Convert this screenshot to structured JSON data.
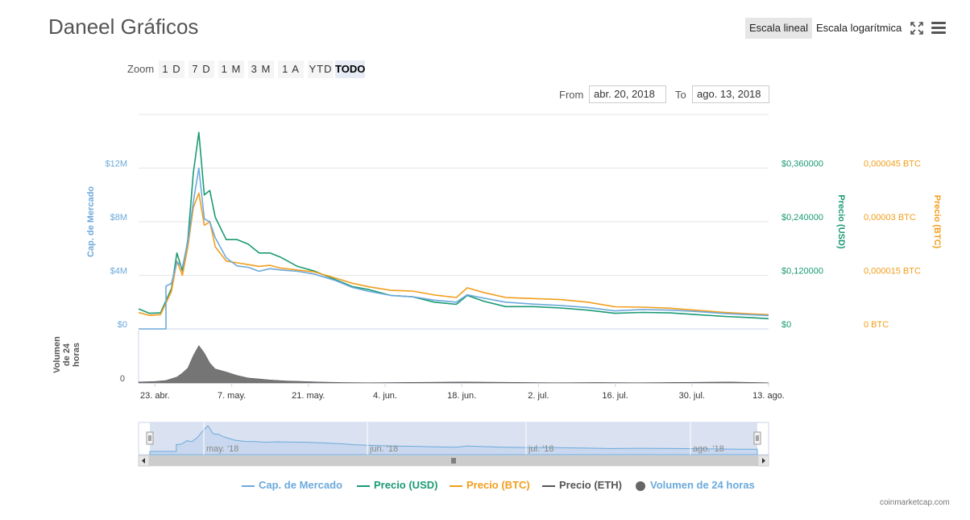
{
  "header": {
    "title": "Daneel Gráficos",
    "linear_scale": "Escala lineal",
    "log_scale": "Escala logarítmica"
  },
  "zoom": {
    "label": "Zoom",
    "buttons": [
      "1 D",
      "7 D",
      "1 M",
      "3 M",
      "1 A",
      "YTD",
      "TODO"
    ],
    "active": "TODO"
  },
  "range": {
    "from_label": "From",
    "from_value": "abr. 20, 2018",
    "to_label": "To",
    "to_value": "ago. 13, 2018"
  },
  "legend": {
    "market_cap": "Cap. de Mercado",
    "price_usd": "Precio (USD)",
    "price_btc": "Precio (BTC)",
    "price_eth": "Precio (ETH)",
    "volume": "Volumen de 24 horas"
  },
  "credits": "coinmarketcap.com",
  "colors": {
    "market_cap": "#6ca9dc",
    "price_usd": "#1a9a74",
    "price_btc": "#f29e1c",
    "price_eth": "#555555",
    "volume": "#555555",
    "navigator_fill": "#d4dcef"
  },
  "chart_data": {
    "type": "line",
    "x_range": [
      "2018-04-20",
      "2018-08-13"
    ],
    "x_ticks": [
      "23. abr.",
      "7. may.",
      "21. may.",
      "4. jun.",
      "18. jun.",
      "2. jul.",
      "16. jul.",
      "30. jul.",
      "13. ago."
    ],
    "axes": {
      "market_cap": {
        "title": "Cap. de Mercado",
        "ticks": [
          "$0",
          "$4M",
          "$8M",
          "$12M"
        ],
        "ylim": [
          0,
          16000000
        ]
      },
      "price_usd": {
        "title": "Precio (USD)",
        "ticks": [
          "$0",
          "$0,120000",
          "$0,240000",
          "$0,360000"
        ],
        "ylim": [
          0,
          0.48
        ]
      },
      "price_btc": {
        "title": "Precio (BTC)",
        "ticks": [
          "0 BTC",
          "0,000015 BTC",
          "0,00003 BTC",
          "0,000045 BTC"
        ],
        "ylim": [
          0,
          6e-05
        ]
      },
      "volume": {
        "title": "Volumen de 24 horas",
        "ticks": [
          "0"
        ]
      }
    },
    "navigator_ticks": [
      "may. '18",
      "jun. '18",
      "jul. '18",
      "ago. '18"
    ],
    "series": [
      {
        "name": "Precio (USD)",
        "axis": "price_usd",
        "color": "#1a9a74",
        "points": [
          [
            "2018-04-20",
            0.045
          ],
          [
            "2018-04-22",
            0.035
          ],
          [
            "2018-04-24",
            0.036
          ],
          [
            "2018-04-26",
            0.09
          ],
          [
            "2018-04-27",
            0.17
          ],
          [
            "2018-04-28",
            0.13
          ],
          [
            "2018-04-29",
            0.2
          ],
          [
            "2018-04-30",
            0.35
          ],
          [
            "2018-05-01",
            0.44
          ],
          [
            "2018-05-02",
            0.3
          ],
          [
            "2018-05-03",
            0.31
          ],
          [
            "2018-05-04",
            0.25
          ],
          [
            "2018-05-06",
            0.2
          ],
          [
            "2018-05-08",
            0.2
          ],
          [
            "2018-05-10",
            0.19
          ],
          [
            "2018-05-12",
            0.17
          ],
          [
            "2018-05-14",
            0.17
          ],
          [
            "2018-05-16",
            0.16
          ],
          [
            "2018-05-19",
            0.14
          ],
          [
            "2018-05-22",
            0.13
          ],
          [
            "2018-05-26",
            0.11
          ],
          [
            "2018-05-29",
            0.095
          ],
          [
            "2018-06-01",
            0.088
          ],
          [
            "2018-06-05",
            0.075
          ],
          [
            "2018-06-09",
            0.072
          ],
          [
            "2018-06-13",
            0.06
          ],
          [
            "2018-06-17",
            0.055
          ],
          [
            "2018-06-19",
            0.075
          ],
          [
            "2018-06-22",
            0.062
          ],
          [
            "2018-06-26",
            0.05
          ],
          [
            "2018-07-01",
            0.05
          ],
          [
            "2018-07-06",
            0.047
          ],
          [
            "2018-07-11",
            0.042
          ],
          [
            "2018-07-16",
            0.035
          ],
          [
            "2018-07-21",
            0.037
          ],
          [
            "2018-07-26",
            0.036
          ],
          [
            "2018-07-31",
            0.032
          ],
          [
            "2018-08-05",
            0.028
          ],
          [
            "2018-08-10",
            0.025
          ],
          [
            "2018-08-13",
            0.023
          ]
        ]
      },
      {
        "name": "Precio (BTC)",
        "axis": "price_btc",
        "color": "#f29e1c",
        "points": [
          [
            "2018-04-20",
            4.6e-06
          ],
          [
            "2018-04-22",
            3.8e-06
          ],
          [
            "2018-04-24",
            4e-06
          ],
          [
            "2018-04-26",
            1.05e-05
          ],
          [
            "2018-04-27",
            1.9e-05
          ],
          [
            "2018-04-28",
            1.5e-05
          ],
          [
            "2018-04-29",
            2.3e-05
          ],
          [
            "2018-04-30",
            3.4e-05
          ],
          [
            "2018-05-01",
            3.8e-05
          ],
          [
            "2018-05-02",
            2.9e-05
          ],
          [
            "2018-05-03",
            3e-05
          ],
          [
            "2018-05-04",
            2.3e-05
          ],
          [
            "2018-05-06",
            1.9e-05
          ],
          [
            "2018-05-08",
            1.85e-05
          ],
          [
            "2018-05-10",
            1.8e-05
          ],
          [
            "2018-05-12",
            1.75e-05
          ],
          [
            "2018-05-14",
            1.78e-05
          ],
          [
            "2018-05-16",
            1.7e-05
          ],
          [
            "2018-05-19",
            1.65e-05
          ],
          [
            "2018-05-22",
            1.6e-05
          ],
          [
            "2018-05-26",
            1.42e-05
          ],
          [
            "2018-05-29",
            1.28e-05
          ],
          [
            "2018-06-01",
            1.18e-05
          ],
          [
            "2018-06-05",
            1.08e-05
          ],
          [
            "2018-06-09",
            1.06e-05
          ],
          [
            "2018-06-13",
            9.5e-06
          ],
          [
            "2018-06-17",
            8.8e-06
          ],
          [
            "2018-06-19",
            1.15e-05
          ],
          [
            "2018-06-22",
            1.02e-05
          ],
          [
            "2018-06-26",
            8.8e-06
          ],
          [
            "2018-07-01",
            8.5e-06
          ],
          [
            "2018-07-06",
            8.2e-06
          ],
          [
            "2018-07-11",
            7.5e-06
          ],
          [
            "2018-07-16",
            6.2e-06
          ],
          [
            "2018-07-21",
            6.1e-06
          ],
          [
            "2018-07-26",
            5.8e-06
          ],
          [
            "2018-07-31",
            5.2e-06
          ],
          [
            "2018-08-05",
            4.6e-06
          ],
          [
            "2018-08-10",
            4.2e-06
          ],
          [
            "2018-08-13",
            4e-06
          ]
        ]
      },
      {
        "name": "Cap. de Mercado",
        "axis": "market_cap",
        "color": "#6ca9dc",
        "points": [
          [
            "2018-04-20",
            0
          ],
          [
            "2018-04-22",
            0
          ],
          [
            "2018-04-24",
            0
          ],
          [
            "2018-04-25",
            0
          ],
          [
            "2018-04-25",
            3200000
          ],
          [
            "2018-04-26",
            3400000
          ],
          [
            "2018-04-27",
            5000000
          ],
          [
            "2018-04-28",
            4600000
          ],
          [
            "2018-04-29",
            6500000
          ],
          [
            "2018-04-30",
            9500000
          ],
          [
            "2018-05-01",
            12000000
          ],
          [
            "2018-05-02",
            8200000
          ],
          [
            "2018-05-03",
            8000000
          ],
          [
            "2018-05-04",
            6800000
          ],
          [
            "2018-05-06",
            5300000
          ],
          [
            "2018-05-08",
            4700000
          ],
          [
            "2018-05-10",
            4600000
          ],
          [
            "2018-05-12",
            4300000
          ],
          [
            "2018-05-14",
            4500000
          ],
          [
            "2018-05-16",
            4400000
          ],
          [
            "2018-05-19",
            4300000
          ],
          [
            "2018-05-22",
            4100000
          ],
          [
            "2018-05-26",
            3600000
          ],
          [
            "2018-05-29",
            3100000
          ],
          [
            "2018-06-01",
            2800000
          ],
          [
            "2018-06-05",
            2500000
          ],
          [
            "2018-06-09",
            2400000
          ],
          [
            "2018-06-13",
            2150000
          ],
          [
            "2018-06-17",
            2000000
          ],
          [
            "2018-06-19",
            2550000
          ],
          [
            "2018-06-22",
            2300000
          ],
          [
            "2018-06-26",
            2000000
          ],
          [
            "2018-07-01",
            1850000
          ],
          [
            "2018-07-06",
            1750000
          ],
          [
            "2018-07-11",
            1600000
          ],
          [
            "2018-07-16",
            1350000
          ],
          [
            "2018-07-21",
            1450000
          ],
          [
            "2018-07-26",
            1400000
          ],
          [
            "2018-07-31",
            1300000
          ],
          [
            "2018-08-05",
            1150000
          ],
          [
            "2018-08-10",
            1050000
          ],
          [
            "2018-08-13",
            1000000
          ]
        ]
      }
    ],
    "volume": {
      "name": "Volumen de 24 horas",
      "points": [
        [
          "2018-04-20",
          0.02
        ],
        [
          "2018-04-23",
          0.03
        ],
        [
          "2018-04-25",
          0.05
        ],
        [
          "2018-04-27",
          0.12
        ],
        [
          "2018-04-28",
          0.2
        ],
        [
          "2018-04-29",
          0.3
        ],
        [
          "2018-04-30",
          0.55
        ],
        [
          "2018-05-01",
          0.75
        ],
        [
          "2018-05-02",
          0.6
        ],
        [
          "2018-05-03",
          0.4
        ],
        [
          "2018-05-04",
          0.28
        ],
        [
          "2018-05-06",
          0.22
        ],
        [
          "2018-05-08",
          0.15
        ],
        [
          "2018-05-10",
          0.1
        ],
        [
          "2018-05-12",
          0.08
        ],
        [
          "2018-05-14",
          0.06
        ],
        [
          "2018-05-17",
          0.04
        ],
        [
          "2018-05-20",
          0.03
        ],
        [
          "2018-05-23",
          0.02
        ],
        [
          "2018-05-27",
          0.01
        ],
        [
          "2018-06-01",
          0.005
        ],
        [
          "2018-06-18",
          0.02
        ],
        [
          "2018-06-25",
          0.015
        ],
        [
          "2018-07-05",
          0.005
        ],
        [
          "2018-07-13",
          0.01
        ],
        [
          "2018-07-20",
          0.005
        ],
        [
          "2018-08-06",
          0.02
        ],
        [
          "2018-08-13",
          0.005
        ]
      ]
    },
    "grid": true,
    "legend_position": "bottom"
  }
}
